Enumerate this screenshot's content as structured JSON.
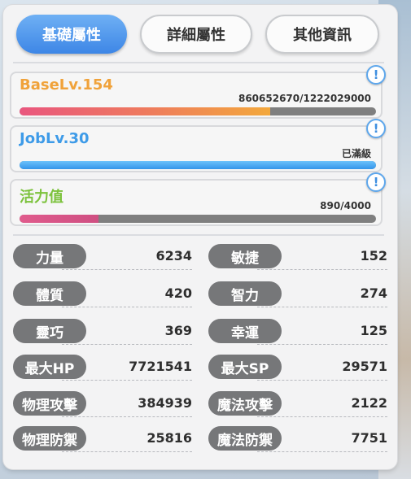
{
  "tabs": [
    {
      "label": "基礎屬性",
      "active": true
    },
    {
      "label": "詳細屬性",
      "active": false
    },
    {
      "label": "其他資訊",
      "active": false
    }
  ],
  "levels": {
    "base": {
      "title": "BaseLv.154",
      "value": "860652670/1222029000",
      "progress": 0.704,
      "color": "#f0a23a"
    },
    "job": {
      "title": "JobLv.30",
      "value": "已滿級",
      "progress": 1.0,
      "color": "#3e9be8"
    },
    "vitality": {
      "title": "活力值",
      "value": "890/4000",
      "progress": 0.2225,
      "color": "#7cc23c"
    }
  },
  "info_icon": {
    "glyph": "!",
    "icon": "info-icon"
  },
  "stats": [
    {
      "label": "力量",
      "value": "6234"
    },
    {
      "label": "敏捷",
      "value": "152"
    },
    {
      "label": "體質",
      "value": "420"
    },
    {
      "label": "智力",
      "value": "274"
    },
    {
      "label": "靈巧",
      "value": "369"
    },
    {
      "label": "幸運",
      "value": "125"
    },
    {
      "label": "最大HP",
      "value": "7721541"
    },
    {
      "label": "最大SP",
      "value": "29571"
    },
    {
      "label": "物理攻擊",
      "value": "384939"
    },
    {
      "label": "魔法攻擊",
      "value": "2122"
    },
    {
      "label": "物理防禦",
      "value": "25816"
    },
    {
      "label": "魔法防禦",
      "value": "7751"
    }
  ]
}
